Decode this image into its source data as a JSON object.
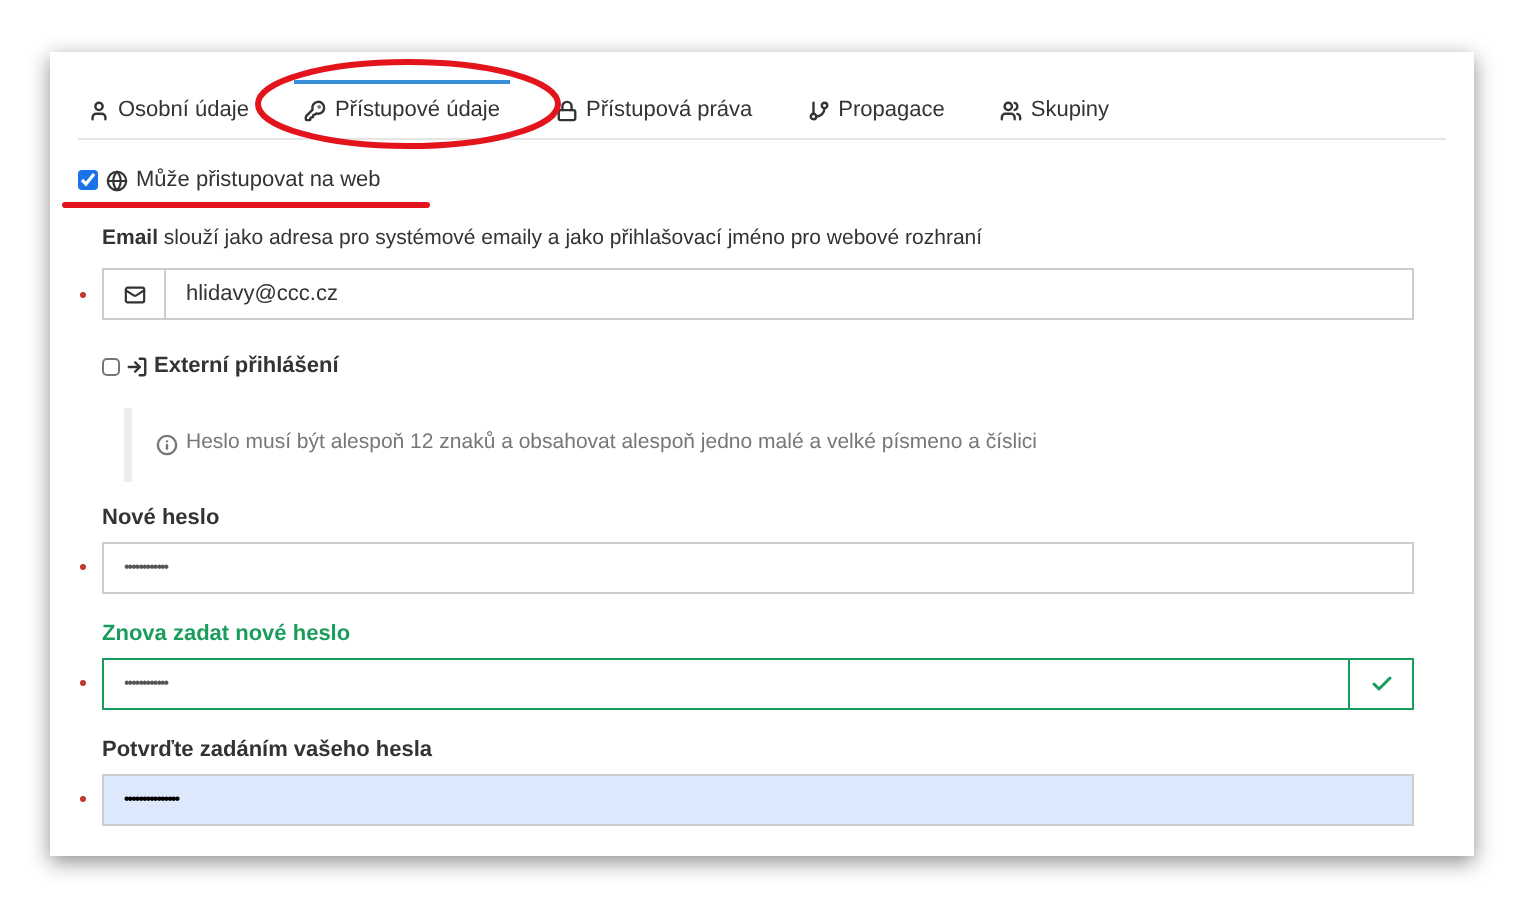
{
  "tabs": [
    {
      "label": "Osobní údaje",
      "selected": false
    },
    {
      "label": "Přístupové údaje",
      "selected": true
    },
    {
      "label": "Přístupová práva",
      "selected": false
    },
    {
      "label": "Propagace",
      "selected": false
    },
    {
      "label": "Skupiny",
      "selected": false
    }
  ],
  "web_access": {
    "label": "Může přistupovat na web",
    "checked": true
  },
  "email_hint": "**Email** slouží jako adresa pro systémové emaily a jako přihlašovací jméno pro webové rozhraní",
  "email": {
    "value": "hlidavy@ccc.cz",
    "required": true
  },
  "external_login": {
    "label": "Externí přihlášení",
    "checked": false
  },
  "password_info": "Heslo musí být alespoň 12 znaků a obsahovat alespoň jedno malé a velké písmeno a číslici",
  "fields": [
    {
      "label": "Nové heslo",
      "value": "••••••••••••",
      "required": true,
      "valid": false,
      "autofilled": false
    },
    {
      "label": "Znova zadat nové heslo",
      "value": "••••••••••••",
      "required": true,
      "valid": true,
      "autofilled": false
    },
    {
      "label": "Potvrďte zadáním vašeho hesla",
      "value": "•••••••••••••••",
      "required": true,
      "valid": false,
      "autofilled": true
    }
  ]
}
